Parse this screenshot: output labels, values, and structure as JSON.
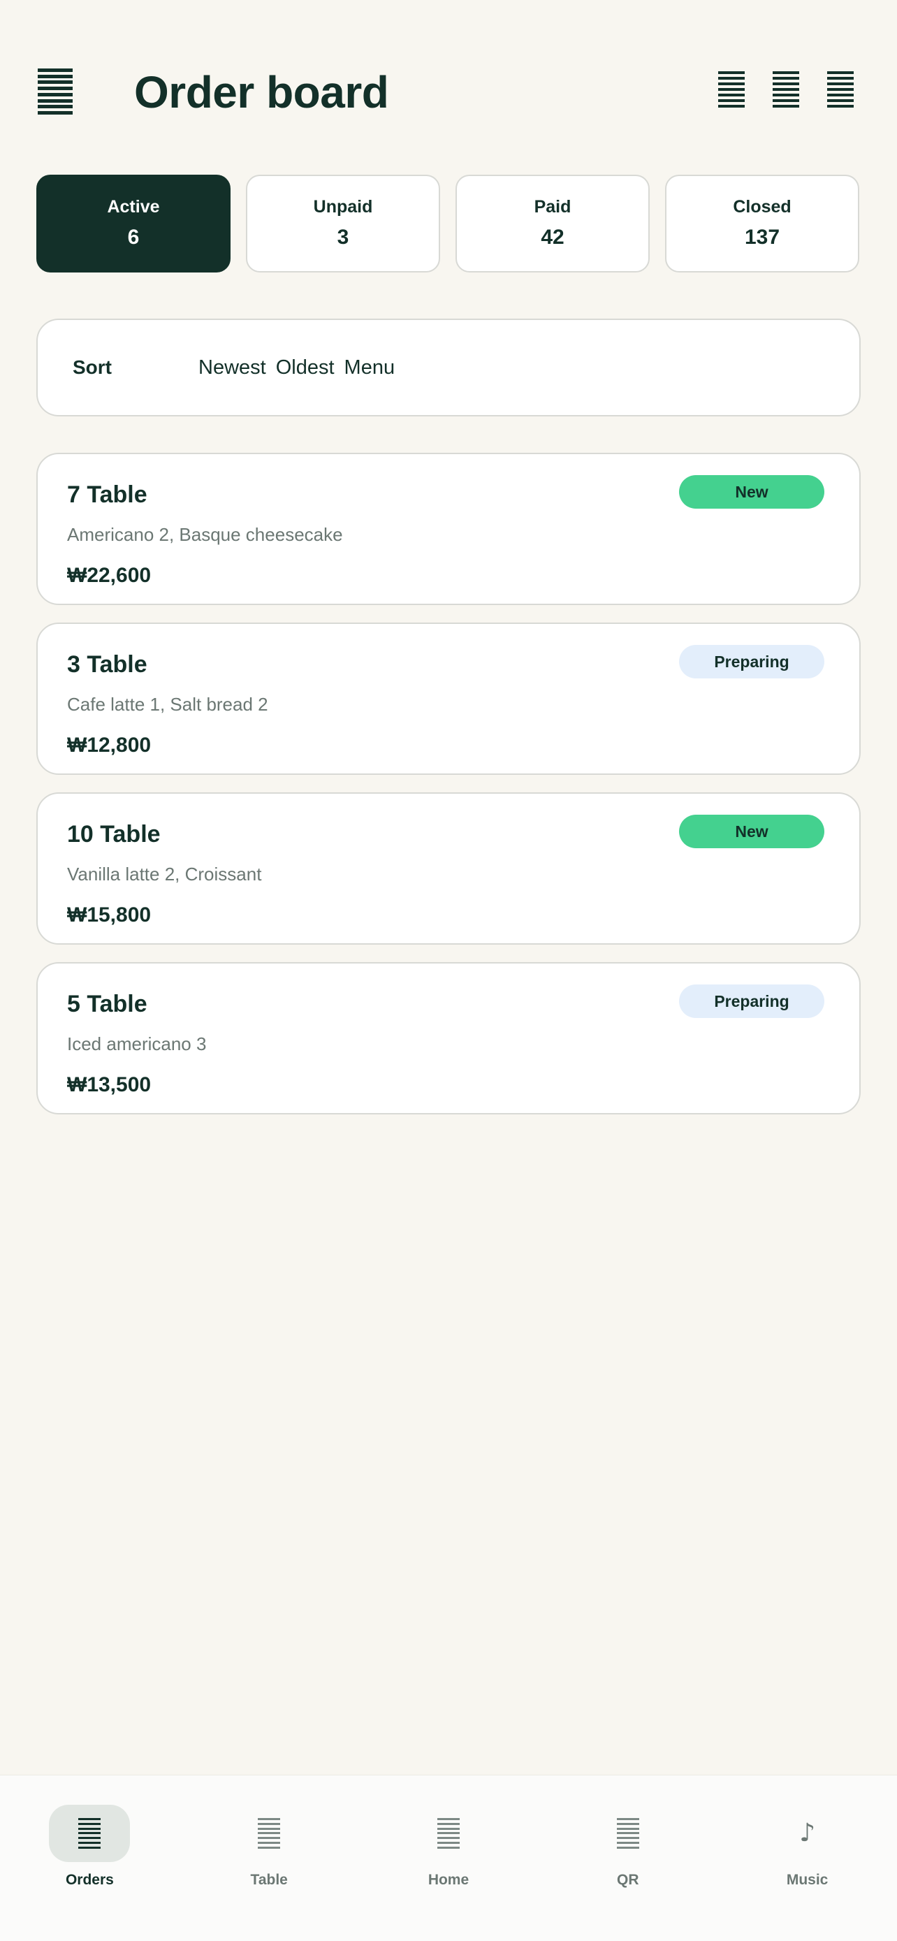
{
  "header": {
    "title": "Order board",
    "menu_icon": "menu-icon",
    "actions": [
      {
        "name": "list-icon"
      },
      {
        "name": "list-icon"
      },
      {
        "name": "list-icon"
      }
    ]
  },
  "filters": [
    {
      "label": "Active",
      "count": "6",
      "active": true
    },
    {
      "label": "Unpaid",
      "count": "3",
      "active": false
    },
    {
      "label": "Paid",
      "count": "42",
      "active": false
    },
    {
      "label": "Closed",
      "count": "137",
      "active": false
    }
  ],
  "sort": {
    "label": "Sort",
    "options": [
      "Newest",
      "Oldest",
      "Menu"
    ]
  },
  "orders": [
    {
      "table": "7 Table",
      "items": "Americano 2, Basque cheesecake",
      "price": "₩22,600",
      "status": "New"
    },
    {
      "table": "3 Table",
      "items": "Cafe latte 1, Salt bread 2",
      "price": "₩12,800",
      "status": "Preparing"
    },
    {
      "table": "10 Table",
      "items": "Vanilla latte 2, Croissant",
      "price": "₩15,800",
      "status": "New"
    },
    {
      "table": "5 Table",
      "items": "Iced americano 3",
      "price": "₩13,500",
      "status": "Preparing"
    }
  ],
  "nav": [
    {
      "label": "Orders",
      "icon": "list-icon",
      "active": true
    },
    {
      "label": "Table",
      "icon": "list-icon",
      "active": false
    },
    {
      "label": "Home",
      "icon": "list-icon",
      "active": false
    },
    {
      "label": "QR",
      "icon": "list-icon",
      "active": false
    },
    {
      "label": "Music",
      "icon": "music-note-icon",
      "active": false
    }
  ],
  "colors": {
    "primary": "#133029",
    "background": "#f8f6f0",
    "status_new": "#44d18f",
    "status_preparing": "#e3eefb"
  }
}
